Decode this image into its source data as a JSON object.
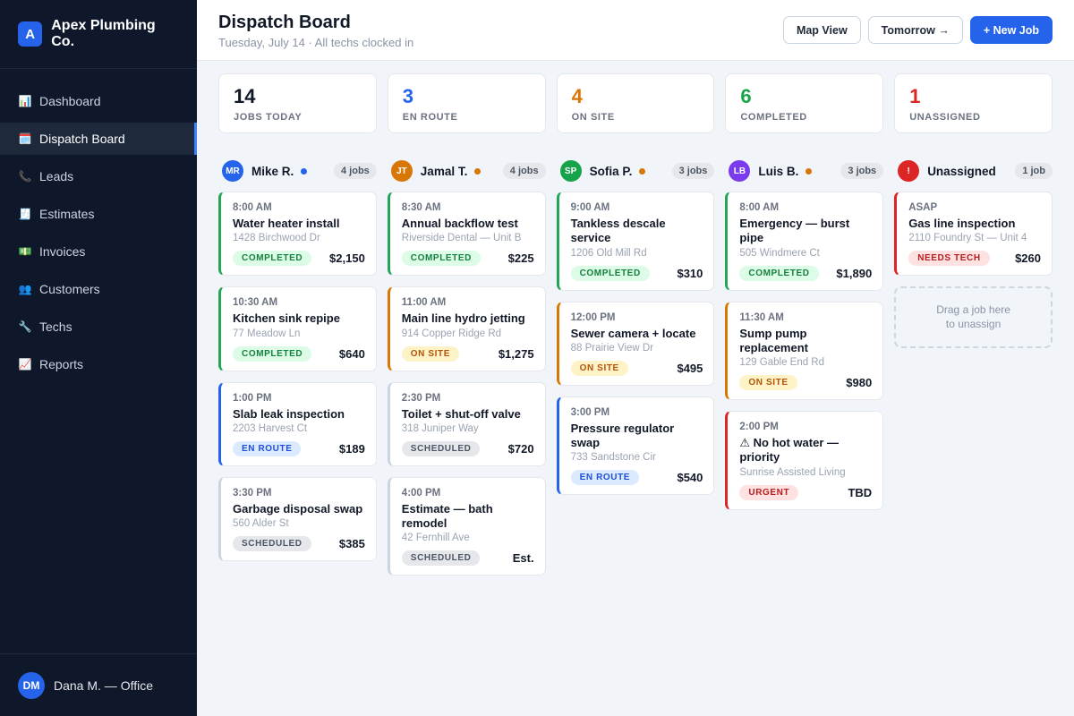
{
  "brand": {
    "initial": "A",
    "name": "Apex Plumbing Co."
  },
  "nav": [
    {
      "icon": "📊",
      "icon_name": "bar-chart-icon",
      "label": "Dashboard",
      "active": false
    },
    {
      "icon": "🗓️",
      "icon_name": "calendar-icon",
      "label": "Dispatch Board",
      "active": true
    },
    {
      "icon": "📞",
      "icon_name": "phone-icon",
      "label": "Leads",
      "active": false
    },
    {
      "icon": "🧾",
      "icon_name": "receipt-icon",
      "label": "Estimates",
      "active": false
    },
    {
      "icon": "💵",
      "icon_name": "money-icon",
      "label": "Invoices",
      "active": false
    },
    {
      "icon": "👥",
      "icon_name": "users-icon",
      "label": "Customers",
      "active": false
    },
    {
      "icon": "🔧",
      "icon_name": "wrench-icon",
      "label": "Techs",
      "active": false
    },
    {
      "icon": "📈",
      "icon_name": "trend-chart-icon",
      "label": "Reports",
      "active": false
    }
  ],
  "user": {
    "initials": "DM",
    "name": "Dana M. — Office"
  },
  "header": {
    "title": "Dispatch Board",
    "subtitle": "Tuesday, July 14 · All techs clocked in",
    "map_view_label": "Map View",
    "tomorrow_label": "Tomorrow →",
    "new_job_label": "+ New Job"
  },
  "stats": [
    {
      "value": "14",
      "label": "JOBS TODAY",
      "color": "#111827"
    },
    {
      "value": "3",
      "label": "EN ROUTE",
      "color": "#2563eb"
    },
    {
      "value": "4",
      "label": "ON SITE",
      "color": "#d97706"
    },
    {
      "value": "6",
      "label": "COMPLETED",
      "color": "#16a34a"
    },
    {
      "value": "1",
      "label": "UNASSIGNED",
      "color": "#dc2626"
    }
  ],
  "columns": [
    {
      "id": "mike",
      "initials": "MR",
      "name": "Mike R.",
      "avatar_color": "#2563eb",
      "dot_color": "#2563eb",
      "count": "4 jobs",
      "jobs": [
        {
          "time": "8:00 AM",
          "title": "Water heater install",
          "address": "1428 Birchwood Dr",
          "status": "COMPLETED",
          "status_key": "completed",
          "price": "$2,150"
        },
        {
          "time": "10:30 AM",
          "title": "Kitchen sink repipe",
          "address": "77 Meadow Ln",
          "status": "COMPLETED",
          "status_key": "completed",
          "price": "$640"
        },
        {
          "time": "1:00 PM",
          "title": "Slab leak inspection",
          "address": "2203 Harvest Ct",
          "status": "EN ROUTE",
          "status_key": "enroute",
          "price": "$189"
        },
        {
          "time": "3:30 PM",
          "title": "Garbage disposal swap",
          "address": "560 Alder St",
          "status": "SCHEDULED",
          "status_key": "scheduled",
          "price": "$385"
        }
      ]
    },
    {
      "id": "jamal",
      "initials": "JT",
      "name": "Jamal T.",
      "avatar_color": "#d97706",
      "dot_color": "#d97706",
      "count": "4 jobs",
      "jobs": [
        {
          "time": "8:30 AM",
          "title": "Annual backflow test",
          "address": "Riverside Dental — Unit B",
          "status": "COMPLETED",
          "status_key": "completed",
          "price": "$225"
        },
        {
          "time": "11:00 AM",
          "title": "Main line hydro jetting",
          "address": "914 Copper Ridge Rd",
          "status": "ON SITE",
          "status_key": "onsite",
          "price": "$1,275"
        },
        {
          "time": "2:30 PM",
          "title": "Toilet + shut-off valve",
          "address": "318 Juniper Way",
          "status": "SCHEDULED",
          "status_key": "scheduled",
          "price": "$720"
        },
        {
          "time": "4:00 PM",
          "title": "Estimate — bath remodel",
          "address": "42 Fernhill Ave",
          "status": "SCHEDULED",
          "status_key": "scheduled",
          "price": "Est."
        }
      ]
    },
    {
      "id": "sofia",
      "initials": "SP",
      "name": "Sofia P.",
      "avatar_color": "#16a34a",
      "dot_color": "#d97706",
      "count": "3 jobs",
      "jobs": [
        {
          "time": "9:00 AM",
          "title": "Tankless descale service",
          "address": "1206 Old Mill Rd",
          "status": "COMPLETED",
          "status_key": "completed",
          "price": "$310"
        },
        {
          "time": "12:00 PM",
          "title": "Sewer camera + locate",
          "address": "88 Prairie View Dr",
          "status": "ON SITE",
          "status_key": "onsite",
          "price": "$495"
        },
        {
          "time": "3:00 PM",
          "title": "Pressure regulator swap",
          "address": "733 Sandstone Cir",
          "status": "EN ROUTE",
          "status_key": "enroute",
          "price": "$540"
        }
      ]
    },
    {
      "id": "luis",
      "initials": "LB",
      "name": "Luis B.",
      "avatar_color": "#7c3aed",
      "dot_color": "#d97706",
      "count": "3 jobs",
      "jobs": [
        {
          "time": "8:00 AM",
          "title": "Emergency — burst pipe",
          "address": "505 Windmere Ct",
          "status": "COMPLETED",
          "status_key": "completed",
          "price": "$1,890"
        },
        {
          "time": "11:30 AM",
          "title": "Sump pump replacement",
          "address": "129 Gable End Rd",
          "status": "ON SITE",
          "status_key": "onsite",
          "price": "$980"
        },
        {
          "time": "2:00 PM",
          "title": "⚠ No hot water — priority",
          "address": "Sunrise Assisted Living",
          "status": "URGENT",
          "status_key": "urgent",
          "price": "TBD"
        }
      ]
    },
    {
      "id": "unassigned",
      "initials": "!",
      "name": "Unassigned",
      "avatar_color": "#dc2626",
      "dot_color": "",
      "count": "1 job",
      "jobs": [
        {
          "time": "ASAP",
          "title": "Gas line inspection",
          "address": "2110 Foundry St — Unit 4",
          "status": "NEEDS TECH",
          "status_key": "needstech",
          "price": "$260"
        }
      ],
      "dropzone": "Drag a job here\nto unassign"
    }
  ]
}
